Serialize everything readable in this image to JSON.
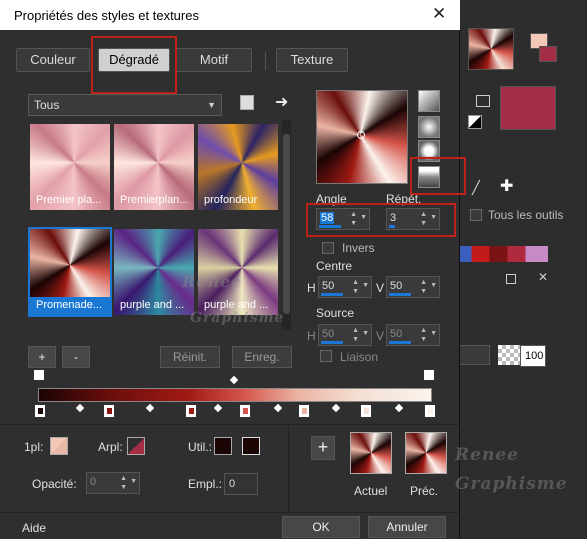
{
  "dialog": {
    "title": "Propriétés des styles et textures",
    "close_glyph": "✕",
    "tabs": [
      "Couleur",
      "Dégradé",
      "Motif",
      "Texture"
    ],
    "active_tab": "Dégradé"
  },
  "library": {
    "dropdown_value": "Tous",
    "items": [
      {
        "label": "Premier pla..."
      },
      {
        "label": "Premierplan..."
      },
      {
        "label": "profondeur"
      },
      {
        "label": "Promenade..."
      },
      {
        "label": "purple and ..."
      },
      {
        "label": "purple and ..."
      }
    ],
    "selected_index": 3
  },
  "ramp_buttons": {
    "add": "+",
    "remove": "-",
    "reset": "Réinit.",
    "save": "Enreg."
  },
  "angle": {
    "label": "Angle",
    "value": "58"
  },
  "repeat": {
    "label": "Répét.",
    "value": "3"
  },
  "invert_label": "Invers",
  "centre": {
    "label": "Centre",
    "h_label": "H",
    "h_value": "50",
    "v_label": "V",
    "v_value": "50"
  },
  "source": {
    "label": "Source",
    "h_label": "H",
    "h_value": "50",
    "v_label": "V",
    "v_value": "50"
  },
  "link_label": "Liaison",
  "bottom": {
    "first_plan_label": "1pl:",
    "arrplan_label": "Arpl:",
    "util_label": "Util.:",
    "opacity_label": "Opacité:",
    "opacity_value": "0",
    "empl_label": "Empl.:",
    "empl_value": "0",
    "actual_label": "Actuel",
    "prev_label": "Préc.",
    "add_glyph": "+"
  },
  "footer": {
    "help": "Aide",
    "ok": "OK",
    "cancel": "Annuler"
  },
  "background_app": {
    "all_tools_label": "Tous les outils",
    "opacity_value": "100",
    "plus_glyph": "✚"
  },
  "watermark": {
    "line1": "Renee",
    "line2": "Graphisme"
  },
  "colors": {
    "accent": "#1a78d4",
    "highlight_box": "#c0201a",
    "ramp_dark": "#1a0404",
    "ramp_mid": "#a01a14",
    "ramp_light": "#fbf3ec",
    "background_color": "#a32d45",
    "foreground_color": "#f4c8b8"
  }
}
